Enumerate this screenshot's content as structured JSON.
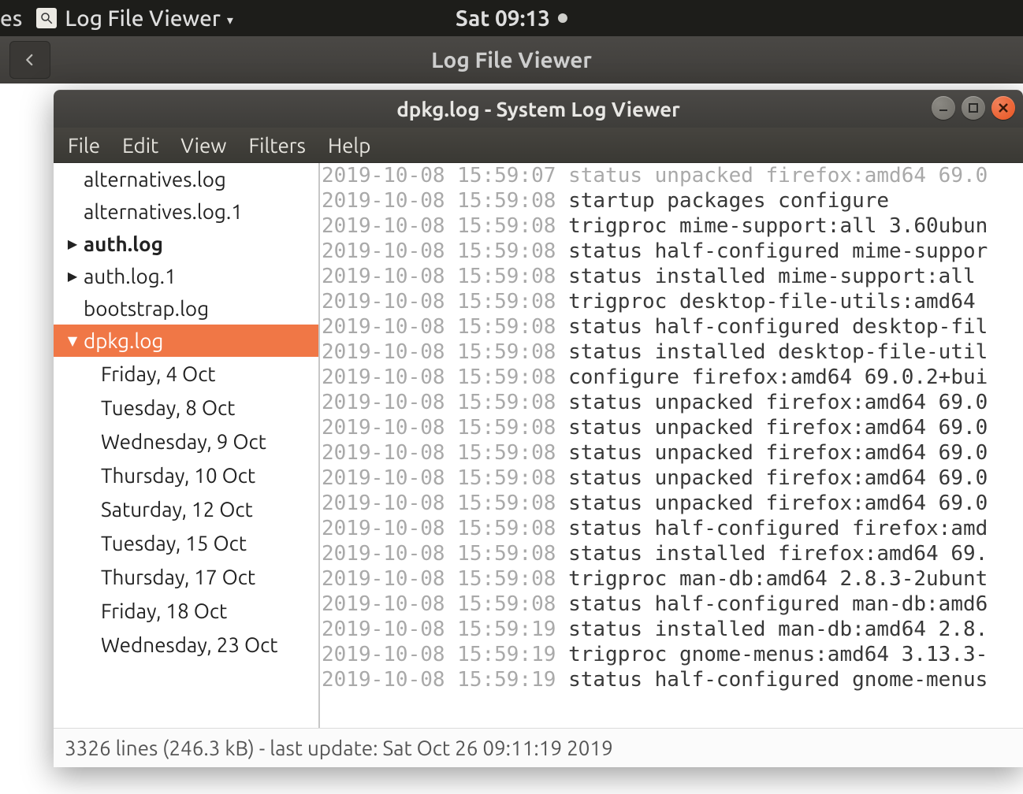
{
  "panel": {
    "left_trunc": "es",
    "app_menu": "Log File Viewer",
    "clock": "Sat 09:13"
  },
  "bg_window": {
    "title": "Log File Viewer"
  },
  "window": {
    "title": "dpkg.log - System Log Viewer"
  },
  "menu": {
    "file": "File",
    "edit": "Edit",
    "view": "View",
    "filters": "Filters",
    "help": "Help"
  },
  "sidebar": {
    "items": [
      {
        "label": "alternatives.log",
        "bold": false,
        "arrow": "",
        "selected": false
      },
      {
        "label": "alternatives.log.1",
        "bold": false,
        "arrow": "",
        "selected": false
      },
      {
        "label": "auth.log",
        "bold": true,
        "arrow": "right",
        "selected": false
      },
      {
        "label": "auth.log.1",
        "bold": false,
        "arrow": "right",
        "selected": false
      },
      {
        "label": "bootstrap.log",
        "bold": false,
        "arrow": "",
        "selected": false
      },
      {
        "label": "dpkg.log",
        "bold": false,
        "arrow": "down",
        "selected": true
      }
    ],
    "children": [
      "Friday,  4 Oct",
      "Tuesday,  8 Oct",
      "Wednesday,  9 Oct",
      "Thursday, 10 Oct",
      "Saturday, 12 Oct",
      "Tuesday, 15 Oct",
      "Thursday, 17 Oct",
      "Friday, 18 Oct",
      "Wednesday, 23 Oct"
    ]
  },
  "log": {
    "lines": [
      {
        "ts": "2019-10-08 15:59:07",
        "msg": "status unpacked firefox:amd64 69.0",
        "dim": true
      },
      {
        "ts": "2019-10-08 15:59:08",
        "msg": "startup packages configure"
      },
      {
        "ts": "2019-10-08 15:59:08",
        "msg": "trigproc mime-support:all 3.60ubun"
      },
      {
        "ts": "2019-10-08 15:59:08",
        "msg": "status half-configured mime-suppor"
      },
      {
        "ts": "2019-10-08 15:59:08",
        "msg": "status installed mime-support:all "
      },
      {
        "ts": "2019-10-08 15:59:08",
        "msg": "trigproc desktop-file-utils:amd64 "
      },
      {
        "ts": "2019-10-08 15:59:08",
        "msg": "status half-configured desktop-fil"
      },
      {
        "ts": "2019-10-08 15:59:08",
        "msg": "status installed desktop-file-util"
      },
      {
        "ts": "2019-10-08 15:59:08",
        "msg": "configure firefox:amd64 69.0.2+bui"
      },
      {
        "ts": "2019-10-08 15:59:08",
        "msg": "status unpacked firefox:amd64 69.0"
      },
      {
        "ts": "2019-10-08 15:59:08",
        "msg": "status unpacked firefox:amd64 69.0"
      },
      {
        "ts": "2019-10-08 15:59:08",
        "msg": "status unpacked firefox:amd64 69.0"
      },
      {
        "ts": "2019-10-08 15:59:08",
        "msg": "status unpacked firefox:amd64 69.0"
      },
      {
        "ts": "2019-10-08 15:59:08",
        "msg": "status unpacked firefox:amd64 69.0"
      },
      {
        "ts": "2019-10-08 15:59:08",
        "msg": "status half-configured firefox:amd"
      },
      {
        "ts": "2019-10-08 15:59:08",
        "msg": "status installed firefox:amd64 69."
      },
      {
        "ts": "2019-10-08 15:59:08",
        "msg": "trigproc man-db:amd64 2.8.3-2ubunt"
      },
      {
        "ts": "2019-10-08 15:59:08",
        "msg": "status half-configured man-db:amd6"
      },
      {
        "ts": "2019-10-08 15:59:19",
        "msg": "status installed man-db:amd64 2.8."
      },
      {
        "ts": "2019-10-08 15:59:19",
        "msg": "trigproc gnome-menus:amd64 3.13.3-"
      },
      {
        "ts": "2019-10-08 15:59:19",
        "msg": "status half-configured gnome-menus"
      }
    ]
  },
  "status": {
    "text": "3326 lines (246.3 kB) - last update: Sat Oct 26 09:11:19 2019"
  }
}
